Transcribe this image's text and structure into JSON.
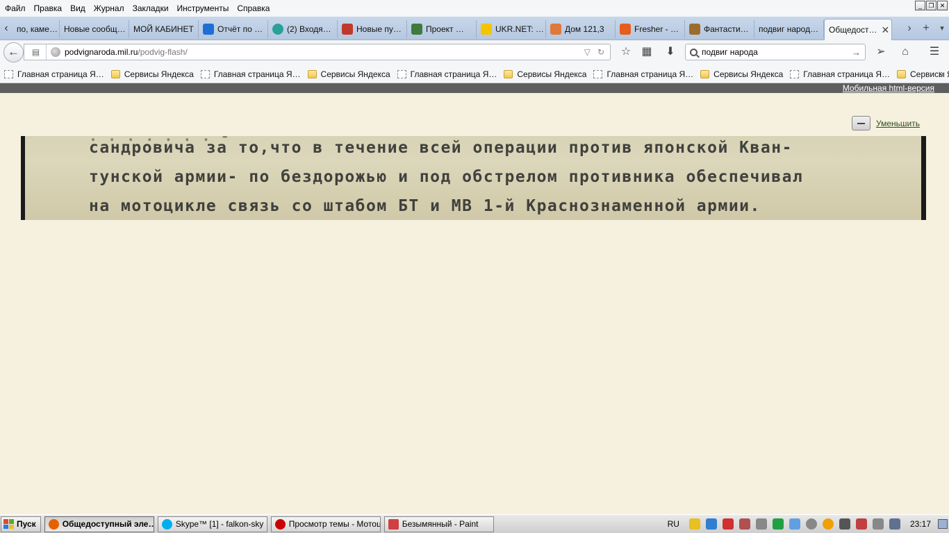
{
  "menu": {
    "items": [
      "Файл",
      "Правка",
      "Вид",
      "Журнал",
      "Закладки",
      "Инструменты",
      "Справка"
    ]
  },
  "window": {
    "minimize": "_",
    "restore": "❐",
    "close": "✕"
  },
  "tabs": [
    {
      "label": "по, каме…",
      "icon_color": "#ffffff"
    },
    {
      "label": "Новые сообщ…",
      "icon_color": "#ffffff"
    },
    {
      "label": "МОЙ КАБИНЕТ",
      "icon_color": "#ffffff"
    },
    {
      "label": "Отчёт по …",
      "icon_color": "#1d6fd4"
    },
    {
      "label": "(2) Входя…",
      "icon_color": "#2aa198"
    },
    {
      "label": "Новые пу…",
      "icon_color": "#c0392b"
    },
    {
      "label": "Проект …",
      "icon_color": "#3f7a3f"
    },
    {
      "label": "UKR.NET: …",
      "icon_color": "#f5c400"
    },
    {
      "label": "Дом 121,3",
      "icon_color": "#e0783c"
    },
    {
      "label": "Fresher - …",
      "icon_color": "#e85d1b"
    },
    {
      "label": "Фантасти…",
      "icon_color": "#9c6b2e"
    },
    {
      "label": "подвиг народ…",
      "icon_color": ""
    },
    {
      "label": "Общедост…",
      "icon_color": "",
      "active": true
    }
  ],
  "navbar": {
    "url_host": "podvignaroda.mil.ru",
    "url_path": "/podvig-flash/",
    "search_value": "подвиг народа"
  },
  "bookmarks": [
    {
      "label": "Главная страница Я…",
      "type": "page"
    },
    {
      "label": "Сервисы Яндекса",
      "type": "folder"
    },
    {
      "label": "Главная страница Я…",
      "type": "page"
    },
    {
      "label": "Сервисы Яндекса",
      "type": "folder"
    },
    {
      "label": "Главная страница Я…",
      "type": "page"
    },
    {
      "label": "Сервисы Яндекса",
      "type": "folder"
    },
    {
      "label": "Главная страница Я…",
      "type": "page"
    },
    {
      "label": "Сервисы Яндекса",
      "type": "folder"
    },
    {
      "label": "Главная страница Я…",
      "type": "page"
    },
    {
      "label": "Сервисы Яндекса",
      "type": "folder"
    }
  ],
  "page": {
    "mobile_link": "Мобильная html-версия",
    "zoom_label": "Уменьшить",
    "document_lines": [
      "сандровича за то,что в течение всей операции против японской Кван-",
      "тунской армии- по бездорожью и под обстрелом противника обеспечивал",
      "на мотоцикле связь со штабом БТ и МВ 1-й Краснознаменной армии."
    ]
  },
  "taskbar": {
    "start_label": "Пуск",
    "tasks": [
      {
        "label": "Общедоступный эле…",
        "icon_color": "#e66000",
        "active": true
      },
      {
        "label": "Skype™ [1] - falkon-sky",
        "icon_color": "#00aff0"
      },
      {
        "label": "Просмотр темы - Мотоц…",
        "icon_color": "#cc0000"
      },
      {
        "label": "Безымянный - Paint",
        "icon_color": "#d04040"
      }
    ],
    "lang": "RU",
    "clock": "23:17",
    "tray_icon_colors": [
      "#e8c020",
      "#2e7fd0",
      "#d03030",
      "#b05050",
      "#888888",
      "#20a040",
      "#60a0e0",
      "#888888",
      "#f0a000",
      "#555555",
      "#c04040",
      "#888888",
      "#607090"
    ]
  }
}
